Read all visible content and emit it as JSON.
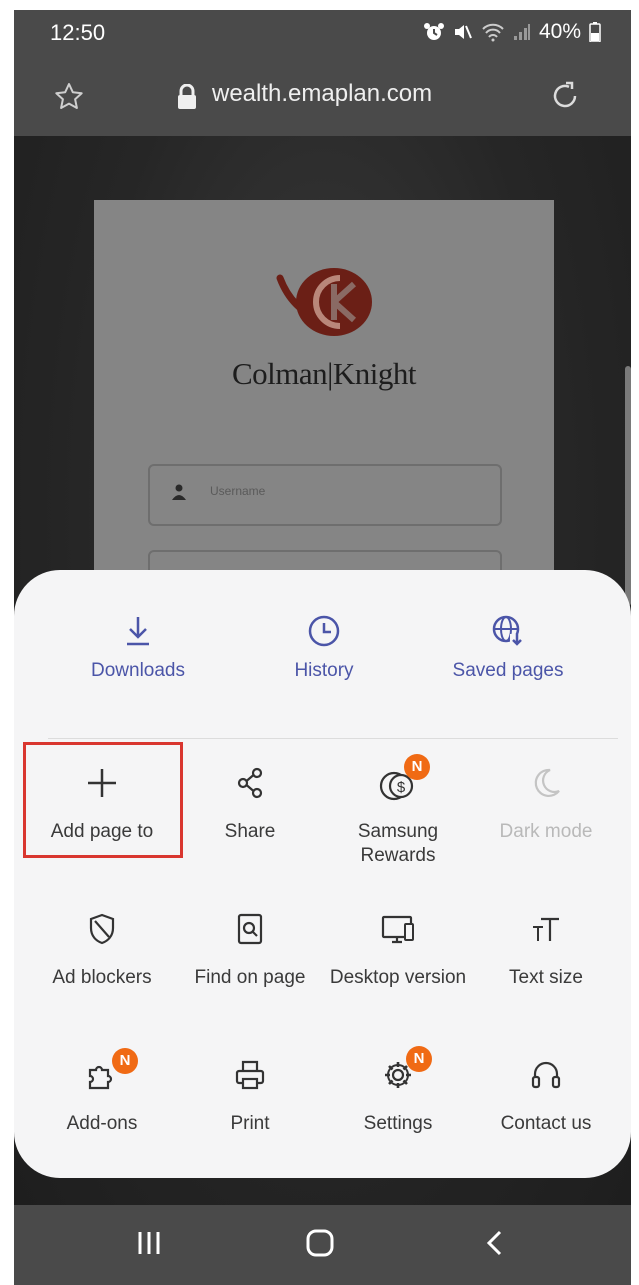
{
  "status_bar": {
    "time": "12:50",
    "battery": "40%"
  },
  "browser": {
    "url": "wealth.emaplan.com"
  },
  "web_page": {
    "brand_name": "Colman|Knight",
    "username_placeholder": "Username"
  },
  "menu": {
    "top_items": [
      {
        "label": "Downloads",
        "icon": "download-icon"
      },
      {
        "label": "History",
        "icon": "clock-icon"
      },
      {
        "label": "Saved pages",
        "icon": "globe-download-icon"
      }
    ],
    "grid_items": [
      {
        "label": "Add page to",
        "icon": "plus-icon",
        "highlighted": true
      },
      {
        "label": "Share",
        "icon": "share-icon"
      },
      {
        "label": "Samsung Rewards",
        "icon": "rewards-icon",
        "badge": "N"
      },
      {
        "label": "Dark mode",
        "icon": "moon-icon",
        "disabled": true
      },
      {
        "label": "Ad blockers",
        "icon": "shield-icon"
      },
      {
        "label": "Find on page",
        "icon": "find-icon"
      },
      {
        "label": "Desktop version",
        "icon": "desktop-icon"
      },
      {
        "label": "Text size",
        "icon": "text-size-icon"
      },
      {
        "label": "Add-ons",
        "icon": "puzzle-icon",
        "badge": "N"
      },
      {
        "label": "Print",
        "icon": "printer-icon"
      },
      {
        "label": "Settings",
        "icon": "gear-icon",
        "badge": "N"
      },
      {
        "label": "Contact us",
        "icon": "headset-icon"
      }
    ]
  },
  "colors": {
    "accent": "#4b55a8",
    "badge": "#f06a14",
    "highlight": "#d9362f",
    "brand_logo": "#6b1f16"
  }
}
